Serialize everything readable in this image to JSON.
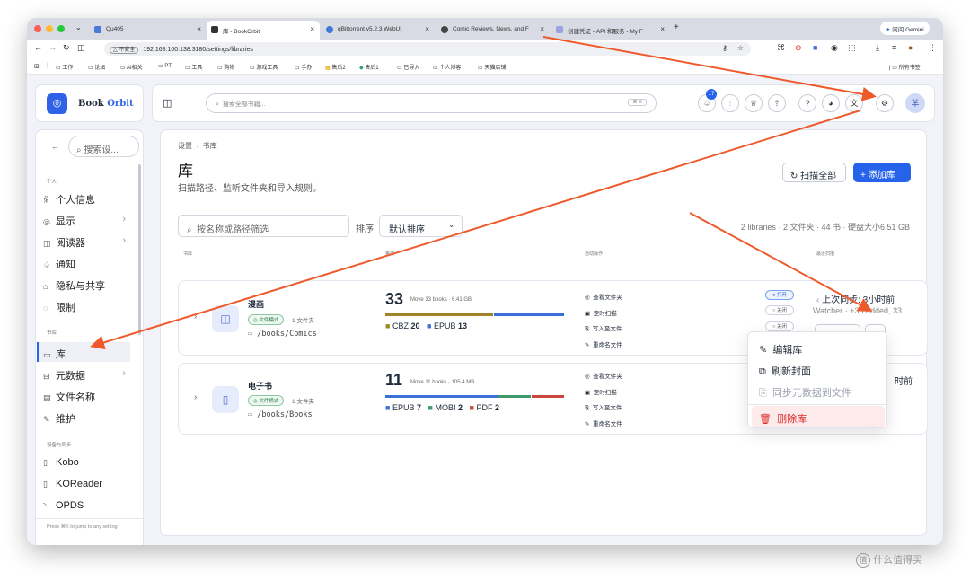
{
  "browser": {
    "tabs": [
      {
        "title": "Qu405",
        "active": false
      },
      {
        "title": "库 - BookOrbit",
        "active": true
      },
      {
        "title": "qBittorrent v5.2.3 WebUI",
        "active": false
      },
      {
        "title": "Comic Reviews, News, and F",
        "active": false
      },
      {
        "title": "创建凭证 - API 和服务 - My F",
        "active": false
      }
    ],
    "new_tab": "+",
    "gemini_button": "问问 Gemini",
    "insecure_label": "不安全",
    "url": "192.168.100.138:3180/settings/libraries",
    "bookmarks": [
      "工作",
      "论坛",
      "AI相关",
      "PT",
      "工具",
      "购物",
      "游戏工具",
      "手办",
      "售后2",
      "售后1",
      "已导入",
      "个人博客",
      "天猫店铺"
    ],
    "all_bookmarks": "所有书签"
  },
  "app": {
    "brand_main": "Book",
    "brand_accent": "Orbit",
    "search_placeholder": "搜索全部书籍...",
    "search_shortcut": "⌘ K",
    "notification_count": "17",
    "avatar_text": "羊"
  },
  "sidebar": {
    "search_placeholder": "搜索设...",
    "sections": [
      {
        "title": "个人",
        "items": [
          {
            "icon": "user-icon",
            "glyph": "ꆜ",
            "label": "个人信息"
          },
          {
            "icon": "display-icon",
            "glyph": "◎",
            "label": "显示",
            "chevron": "›"
          },
          {
            "icon": "reader-icon",
            "glyph": "◫",
            "label": "阅读器",
            "chevron": "›"
          },
          {
            "icon": "bell-icon",
            "glyph": "♤",
            "label": "通知"
          },
          {
            "icon": "lock-icon",
            "glyph": "⌂",
            "label": "隐私与共享"
          },
          {
            "icon": "shield-icon",
            "glyph": "◌",
            "label": "限制"
          }
        ]
      },
      {
        "title": "书库",
        "items": [
          {
            "icon": "folder-icon",
            "glyph": "▭",
            "label": "库",
            "active": true
          },
          {
            "icon": "metadata-icon",
            "glyph": "⊟",
            "label": "元数据",
            "chevron": "›"
          },
          {
            "icon": "file-icon",
            "glyph": "▤",
            "label": "文件名称"
          },
          {
            "icon": "wrench-icon",
            "glyph": "✎",
            "label": "维护"
          }
        ]
      },
      {
        "title": "设备与同步",
        "items": [
          {
            "icon": "device-icon",
            "glyph": "▯",
            "label": "Kobo"
          },
          {
            "icon": "device-icon",
            "glyph": "▯",
            "label": "KOReader"
          },
          {
            "icon": "rss-icon",
            "glyph": "◝",
            "label": "OPDS"
          }
        ]
      }
    ],
    "footer_hint": "Press ⌘K to jump to any setting"
  },
  "main": {
    "breadcrumb": [
      "设置",
      "书库"
    ],
    "title": "库",
    "subtitle": "扫描路径、监听文件夹和导入规则。",
    "scan_all": "扫描全部",
    "add_library": "+ 添加库",
    "filter_placeholder": "按名称或路径筛选",
    "sort_label": "排序",
    "sort_value": "默认排序",
    "stats": [
      "2 libraries",
      "2 文件夹",
      "44 书",
      "硬盘大小6.51 GB"
    ],
    "columns": [
      "书库",
      "格式",
      "自动操作",
      "最近扫描"
    ],
    "libraries": [
      {
        "name": "漫画",
        "mode": "文件模式",
        "folders": "1 文件夹",
        "path": "/books/Comics",
        "count": "33",
        "count_detail": "Move 33 books · 6.41 GB",
        "formats": [
          {
            "name": "CBZ",
            "value": 20,
            "color": "#a0842a"
          },
          {
            "name": "EPUB",
            "value": 13,
            "color": "#3b6fd9"
          }
        ],
        "actions": [
          {
            "label": "查看文件夹",
            "state": "打开",
            "on": true
          },
          {
            "label": "定时扫描",
            "state": "关闭",
            "on": false
          },
          {
            "label": "写入至文件",
            "state": "关闭",
            "on": false
          },
          {
            "label": "重命名文件",
            "state": "关闭",
            "on": false
          }
        ],
        "last_sync": "上次同步: 3小时前",
        "watcher": "Watcher · +33 added, 33",
        "scan": "扫描",
        "more": "···"
      },
      {
        "name": "电子书",
        "mode": "文件模式",
        "folders": "1 文件夹",
        "path": "/books/Books",
        "count": "11",
        "count_detail": "Move 11 books · 105.4 MB",
        "formats": [
          {
            "name": "EPUB",
            "value": 7,
            "color": "#3b6fd9"
          },
          {
            "name": "MOBI",
            "value": 2,
            "color": "#3e9a6c"
          },
          {
            "name": "PDF",
            "value": 2,
            "color": "#c9463b"
          }
        ],
        "actions": [
          {
            "label": "查看文件夹"
          },
          {
            "label": "定时扫描"
          },
          {
            "label": "写入至文件"
          },
          {
            "label": "重命名文件"
          }
        ],
        "last_sync": "时前"
      }
    ]
  },
  "context_menu": [
    {
      "icon": "pencil-icon",
      "glyph": "✎",
      "label": "编辑库"
    },
    {
      "icon": "image-refresh-icon",
      "glyph": "⧉",
      "label": "刷新封面"
    },
    {
      "icon": "sync-file-icon",
      "glyph": "⎘",
      "label": "同步元数据到文件",
      "disabled": true
    },
    {
      "icon": "trash-icon",
      "glyph": "🗑",
      "label": "删除库",
      "danger": true
    }
  ],
  "watermark": "什么值得买",
  "colors": {
    "accent": "#2563eb",
    "annotation": "#ef5a2c",
    "danger": "#dc2626"
  }
}
